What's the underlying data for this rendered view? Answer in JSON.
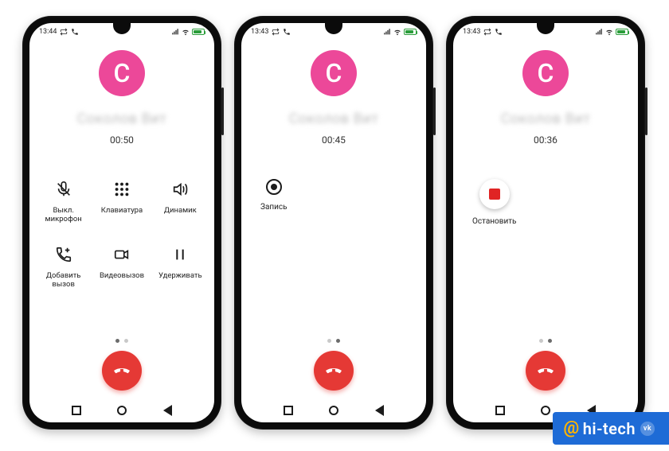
{
  "avatar_initial": "C",
  "caller_name_blurred": "Соколов Вит",
  "statusbar": {
    "signal_icon": "signal-icon",
    "wifi_icon": "wifi-icon",
    "battery_icon": "battery-icon"
  },
  "phones": [
    {
      "time": "13:44",
      "timer": "00:50",
      "page_dots": {
        "count": 2,
        "active": 0
      },
      "actions": [
        {
          "key": "mute",
          "label": "Выкл. микрофон"
        },
        {
          "key": "keypad",
          "label": "Клавиатура"
        },
        {
          "key": "speaker",
          "label": "Динамик"
        },
        {
          "key": "add",
          "label": "Добавить вызов"
        },
        {
          "key": "video",
          "label": "Видеовызов"
        },
        {
          "key": "hold",
          "label": "Удерживать"
        }
      ]
    },
    {
      "time": "13:43",
      "timer": "00:45",
      "page_dots": {
        "count": 2,
        "active": 1
      },
      "record": {
        "state": "idle",
        "label": "Запись"
      }
    },
    {
      "time": "13:43",
      "timer": "00:36",
      "page_dots": {
        "count": 2,
        "active": 1
      },
      "record": {
        "state": "recording",
        "label": "Остановить"
      }
    }
  ],
  "nav": {
    "recents": "recents",
    "home": "home",
    "back": "back"
  },
  "hangup_label": "end-call",
  "watermark": {
    "at": "@",
    "text": "hi-tech",
    "badge": "vk"
  }
}
